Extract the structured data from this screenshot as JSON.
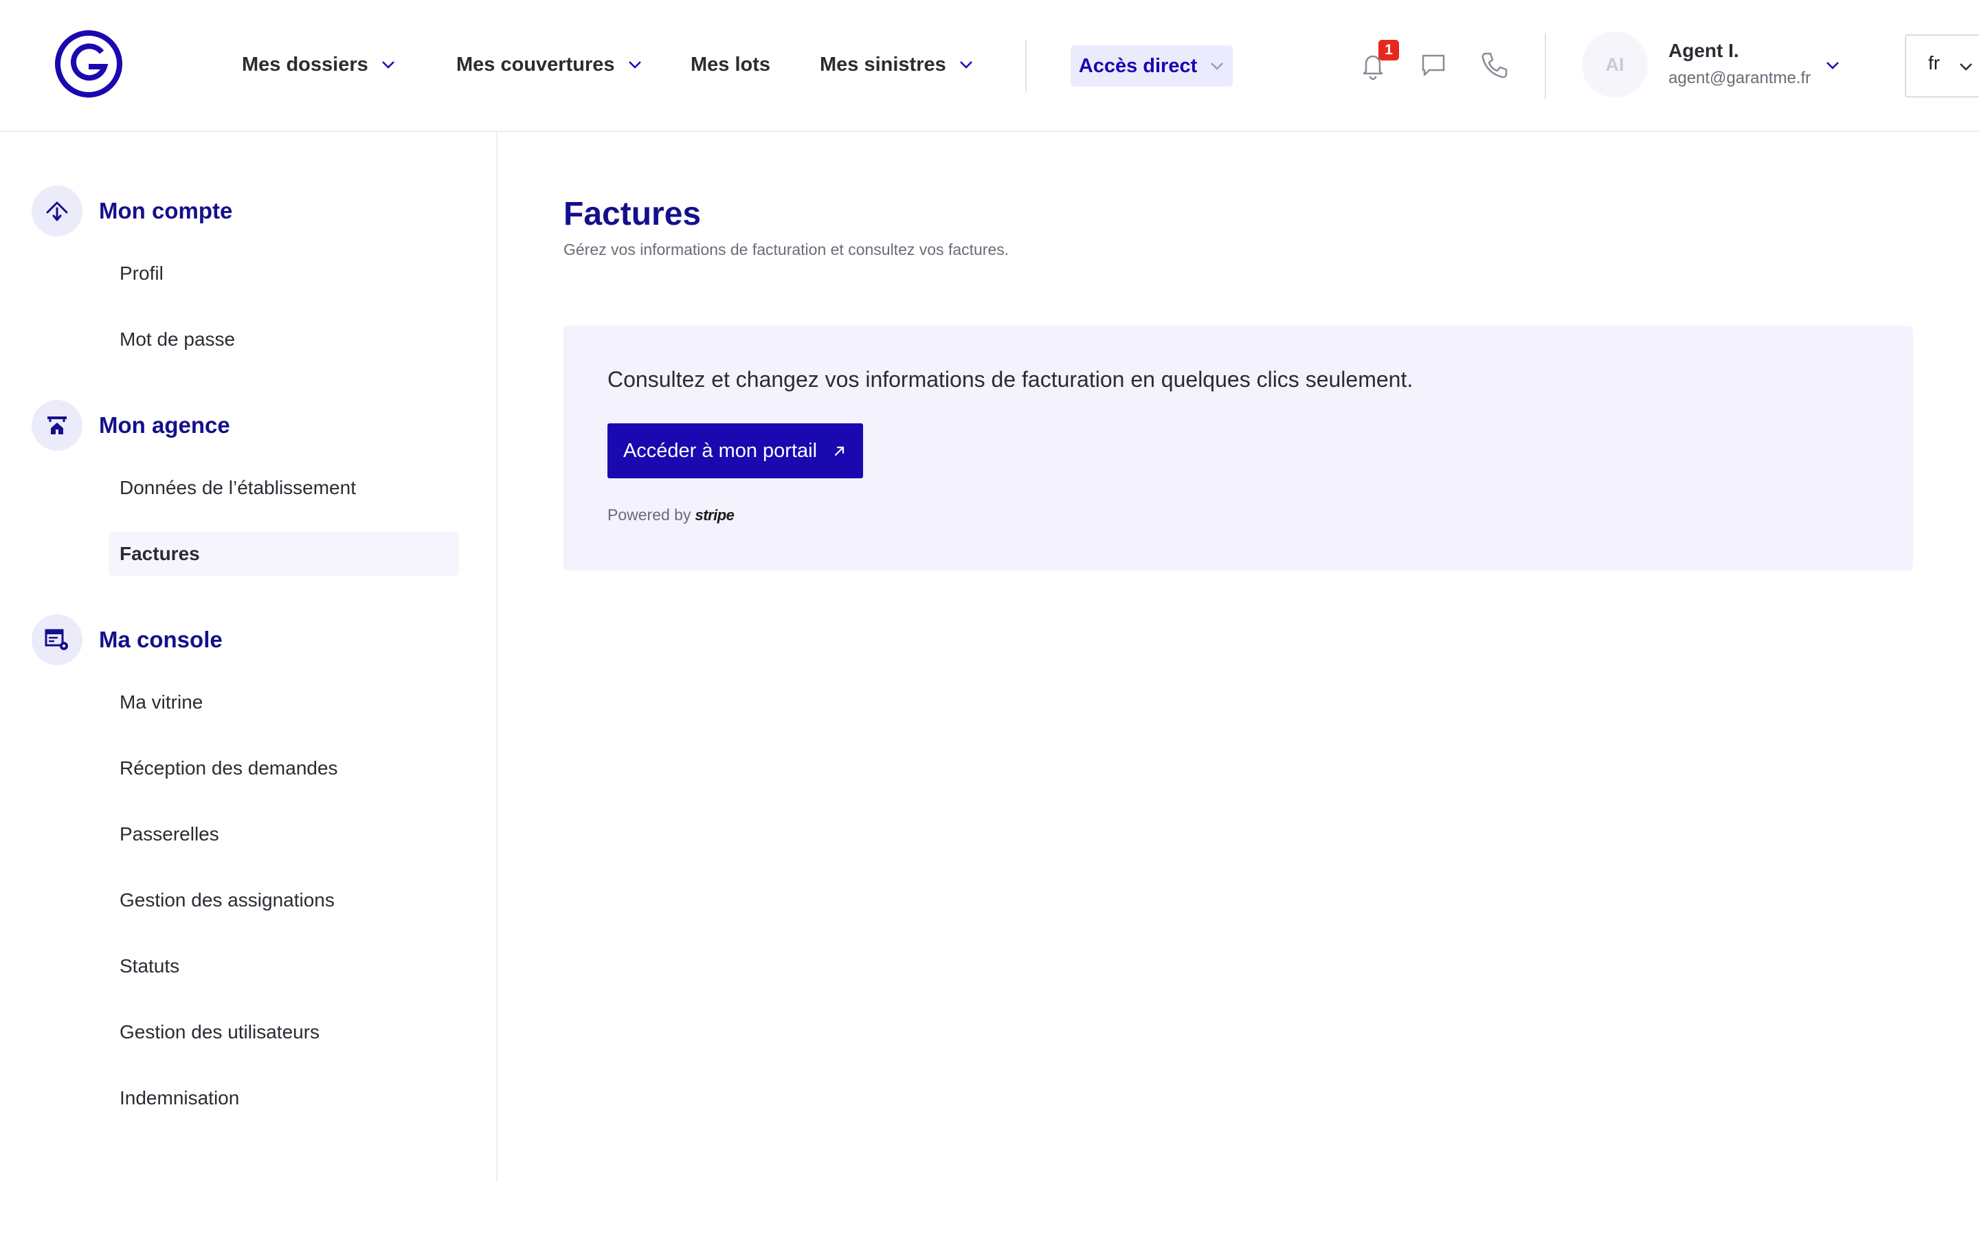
{
  "header": {
    "nav": [
      {
        "label": "Mes dossiers",
        "has_dropdown": true
      },
      {
        "label": "Mes couvertures",
        "has_dropdown": true
      },
      {
        "label": "Mes lots",
        "has_dropdown": false
      },
      {
        "label": "Mes sinistres",
        "has_dropdown": true
      }
    ],
    "quick_access_label": "Accès direct",
    "notification_count": "1",
    "user": {
      "initials": "AI",
      "name": "Agent I.",
      "email": "agent@garantme.fr"
    },
    "language": "fr"
  },
  "sidebar": {
    "sections": [
      {
        "title": "Mon compte",
        "icon": "home-arrow-icon",
        "items": [
          "Profil",
          "Mot de passe"
        ]
      },
      {
        "title": "Mon agence",
        "icon": "agency-icon",
        "items": [
          "Données de l’établissement",
          "Factures"
        ]
      },
      {
        "title": "Ma console",
        "icon": "console-icon",
        "items": [
          "Ma vitrine",
          "Réception des demandes",
          "Passerelles",
          "Gestion des assignations",
          "Statuts",
          "Gestion des utilisateurs",
          "Indemnisation"
        ]
      }
    ],
    "active_item": "Factures"
  },
  "main": {
    "title": "Factures",
    "subtitle": "Gérez vos informations de facturation et consultez vos factures.",
    "card": {
      "text": "Consultez et changez vos informations de facturation en quelques clics seulement.",
      "button_label": "Accéder à mon portail",
      "powered_by": "Powered by",
      "provider": "stripe"
    }
  },
  "colors": {
    "brand": "#1a08b0",
    "brand_dark": "#14108a",
    "accent_bg": "#ecebfd",
    "card_bg": "#f3f2fd",
    "badge": "#e8271e"
  }
}
